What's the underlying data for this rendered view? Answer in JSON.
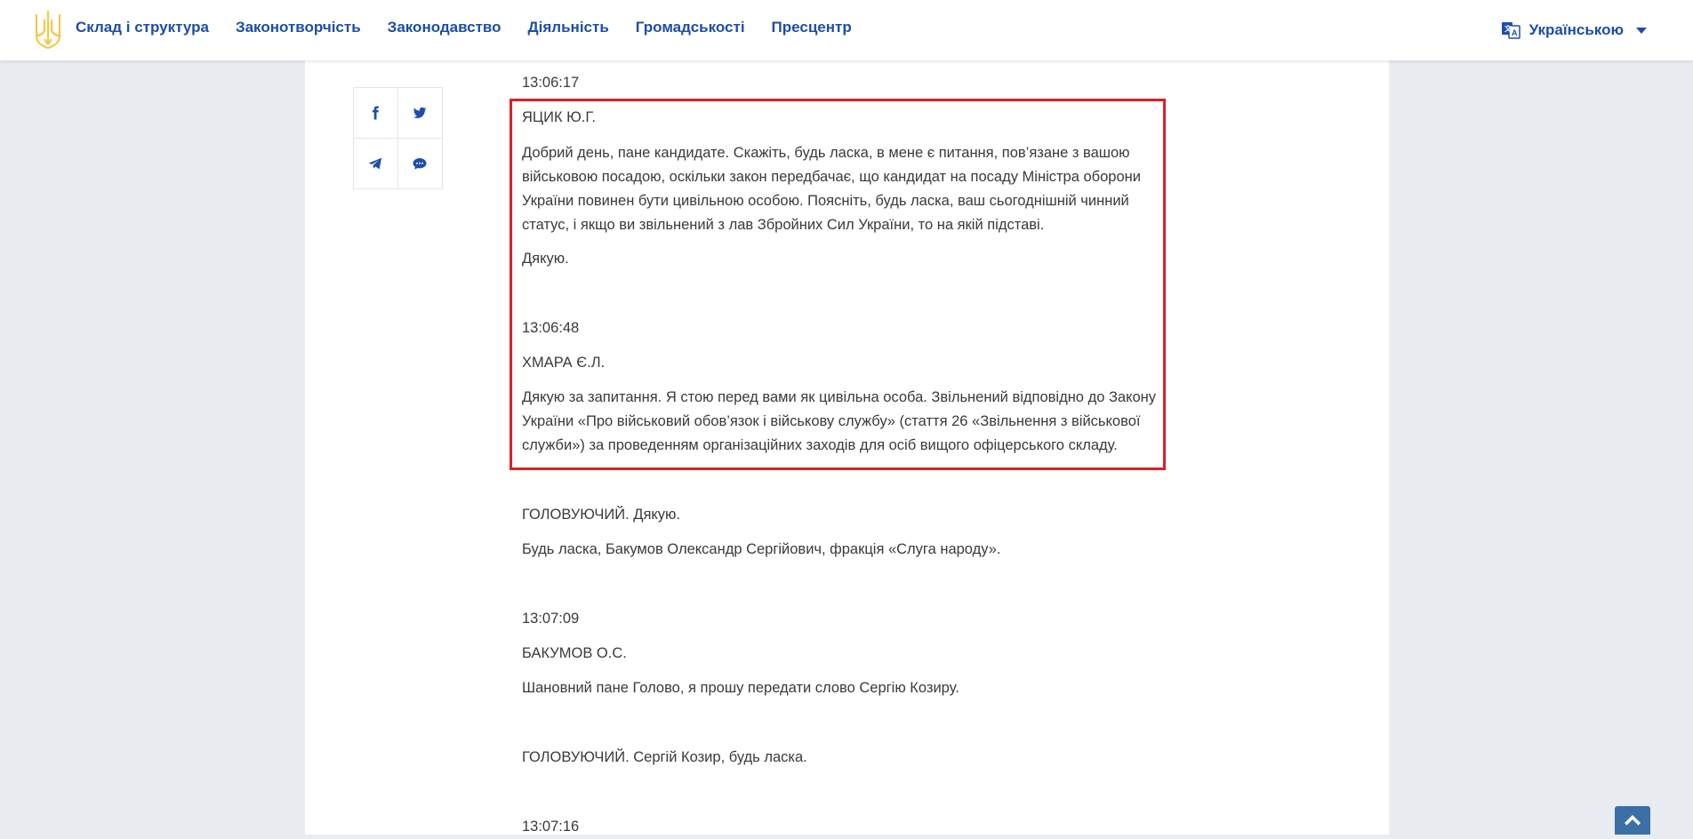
{
  "header": {
    "nav": [
      "Склад і структура",
      "Законотворчість",
      "Законодавство",
      "Діяльність",
      "Громадськості",
      "Пресцентр"
    ],
    "language": "Українською",
    "accent_color": "#1d4ea8",
    "logo_color": "#f2c94c"
  },
  "share": {
    "icons": [
      "facebook-icon",
      "twitter-icon",
      "telegram-icon",
      "chat-icon"
    ]
  },
  "transcript": {
    "entries": [
      {
        "text": "13:06:17"
      },
      {
        "text": "ЯЦИК Ю.Г."
      },
      {
        "text": "Добрий день, пане кандидате. Скажіть, будь ласка, в мене є питання, пов’язане з вашою військовою посадою, оскільки закон передбачає, що кандидат на посаду Міністра оборони України повинен бути цивільною особою. Поясніть, будь ласка, ваш сьогоднішній чинний статус, і якщо ви звільнений з лав Збройних Сил України, то на якій підставі."
      },
      {
        "text": "Дякую."
      },
      {
        "text": "13:06:48"
      },
      {
        "text": "ХМАРА Є.Л."
      },
      {
        "text": "Дякую за запитання. Я стою перед вами як цивільна особа. Звільнений відповідно до Закону України «Про військовий обов’язок і військову службу» (стаття 26  «Звільнення з військової служби») за проведенням організаційних заходів для осіб вищого офіцерського складу."
      },
      {
        "text": "ГОЛОВУЮЧИЙ. Дякую."
      },
      {
        "text": "Будь ласка, Бакумов Олександр Сергійович, фракція «Слуга народу»."
      },
      {
        "text": "13:07:09"
      },
      {
        "text": "БАКУМОВ О.С."
      },
      {
        "text": "Шановний пане Голово, я прошу передати слово Сергію Козиру."
      },
      {
        "text": "ГОЛОВУЮЧИЙ. Сергій Козир, будь ласка."
      },
      {
        "text": "13:07:16"
      }
    ],
    "highlight_color": "#e01e25"
  }
}
